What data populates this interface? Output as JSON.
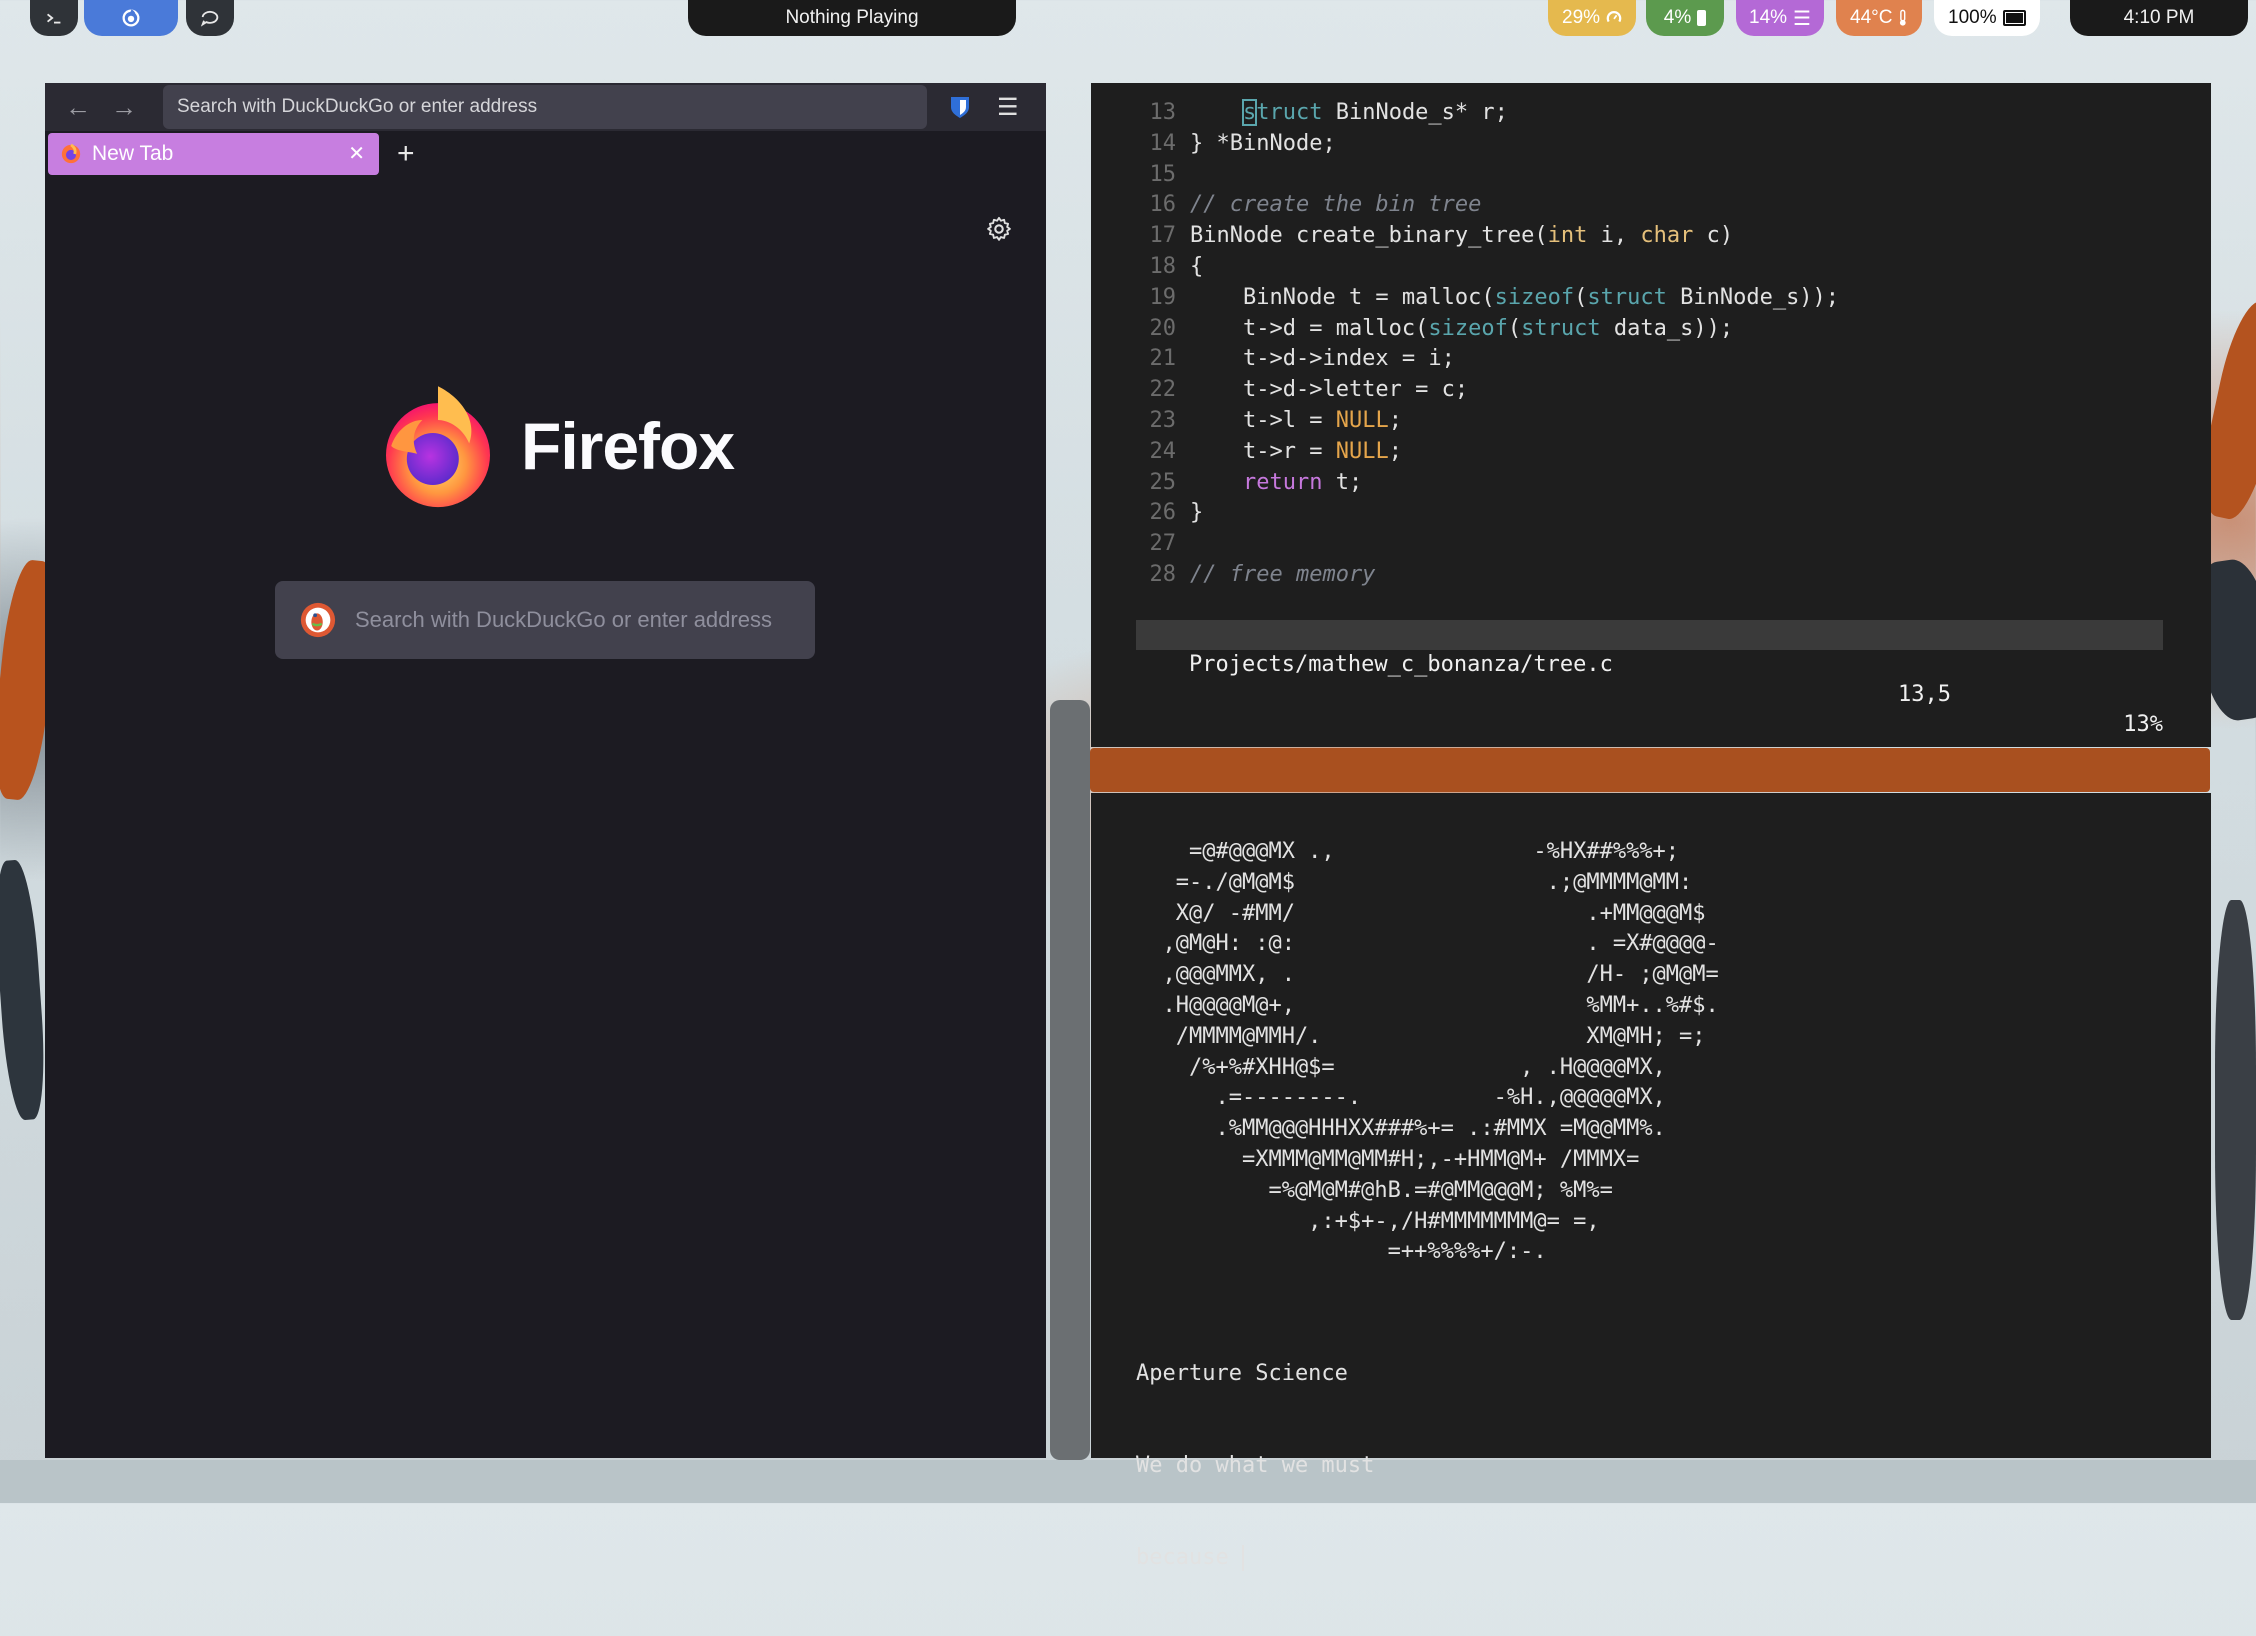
{
  "topbar": {
    "workspaces": [
      {
        "icon": "terminal-icon",
        "active": false
      },
      {
        "icon": "firefox-icon",
        "active": true
      },
      {
        "icon": "chat-icon",
        "active": false
      }
    ],
    "now_playing": "Nothing Playing",
    "stats": {
      "cpu": "29%",
      "cpu_color": "#e5b94e",
      "memory": "4%",
      "memory_color": "#5c9a4e",
      "disk": "14%",
      "disk_color": "#b469d6",
      "temperature": "44°C",
      "temperature_color": "#e0824e",
      "battery": "100%"
    },
    "clock": "4:10 PM"
  },
  "firefox": {
    "url_placeholder": "Search with DuckDuckGo or enter address",
    "tab_title": "New Tab",
    "tab_color": "#c77ee0",
    "brand_name": "Firefox",
    "search_placeholder": "Search with DuckDuckGo or enter address"
  },
  "editor": {
    "lines": [
      {
        "n": "13",
        "segs": [
          {
            "t": "    "
          },
          {
            "t": "s",
            "c": "kw cursor-box"
          },
          {
            "t": "truct",
            "c": "kw"
          },
          {
            "t": " BinNode_s* r;"
          }
        ]
      },
      {
        "n": "14",
        "segs": [
          {
            "t": "} *BinNode;"
          }
        ]
      },
      {
        "n": "15",
        "segs": []
      },
      {
        "n": "16",
        "segs": [
          {
            "t": "// create the bin tree",
            "c": "cm"
          }
        ]
      },
      {
        "n": "17",
        "segs": [
          {
            "t": "BinNode create_binary_tree("
          },
          {
            "t": "int",
            "c": "ty"
          },
          {
            "t": " i, "
          },
          {
            "t": "char",
            "c": "ty"
          },
          {
            "t": " c)"
          }
        ]
      },
      {
        "n": "18",
        "segs": [
          {
            "t": "{"
          }
        ]
      },
      {
        "n": "19",
        "segs": [
          {
            "t": "    BinNode t = malloc("
          },
          {
            "t": "sizeof",
            "c": "kw"
          },
          {
            "t": "("
          },
          {
            "t": "struct",
            "c": "kw"
          },
          {
            "t": " BinNode_s));"
          }
        ]
      },
      {
        "n": "20",
        "segs": [
          {
            "t": "    t->d = malloc("
          },
          {
            "t": "sizeof",
            "c": "kw"
          },
          {
            "t": "("
          },
          {
            "t": "struct",
            "c": "kw"
          },
          {
            "t": " data_s));"
          }
        ]
      },
      {
        "n": "21",
        "segs": [
          {
            "t": "    t->d->index = i;"
          }
        ]
      },
      {
        "n": "22",
        "segs": [
          {
            "t": "    t->d->letter = c;"
          }
        ]
      },
      {
        "n": "23",
        "segs": [
          {
            "t": "    t->l = "
          },
          {
            "t": "NULL",
            "c": "nu"
          },
          {
            "t": ";"
          }
        ]
      },
      {
        "n": "24",
        "segs": [
          {
            "t": "    t->r = "
          },
          {
            "t": "NULL",
            "c": "nu"
          },
          {
            "t": ";"
          }
        ]
      },
      {
        "n": "25",
        "segs": [
          {
            "t": "    "
          },
          {
            "t": "return",
            "c": "rt"
          },
          {
            "t": " t;"
          }
        ]
      },
      {
        "n": "26",
        "segs": [
          {
            "t": "}"
          }
        ]
      },
      {
        "n": "27",
        "segs": []
      },
      {
        "n": "28",
        "segs": [
          {
            "t": "// free memory",
            "c": "cm"
          }
        ]
      }
    ],
    "status_file": "Projects/mathew_c_bonanza/tree.c",
    "status_pos": "13,5",
    "status_pct": "13%"
  },
  "shell": {
    "ascii_art": [
      "    =@#@@@MX .,               -%HX##%%%+;",
      "   =-./@M@M$                   .;@MMMM@MM:",
      "   X@/ -#MM/                      .+MM@@@M$",
      "  ,@M@H: :@:                      . =X#@@@@-",
      "  ,@@@MMX, .                      /H- ;@M@M=",
      "  .H@@@@M@+,                      %MM+..%#$.",
      "   /MMMM@MMH/.                    XM@MH; =;",
      "    /%+%#XHH@$=              , .H@@@@MX,",
      "      .=--------.          -%H.,@@@@@MX,",
      "      .%MM@@@HHHXX###%+= .:#MMX =M@@MM%.",
      "        =XMMM@MM@MM#H;,-+HMM@M+ /MMMX=",
      "          =%@M@M#@hB.=#@MM@@@M; %M%=",
      "             ,:+$+-,/H#MMMMMMM@= =,",
      "                   =++%%%%+/:-."
    ],
    "output_lines": [
      "Aperture Science",
      "We do what we must",
      "because "
    ]
  }
}
